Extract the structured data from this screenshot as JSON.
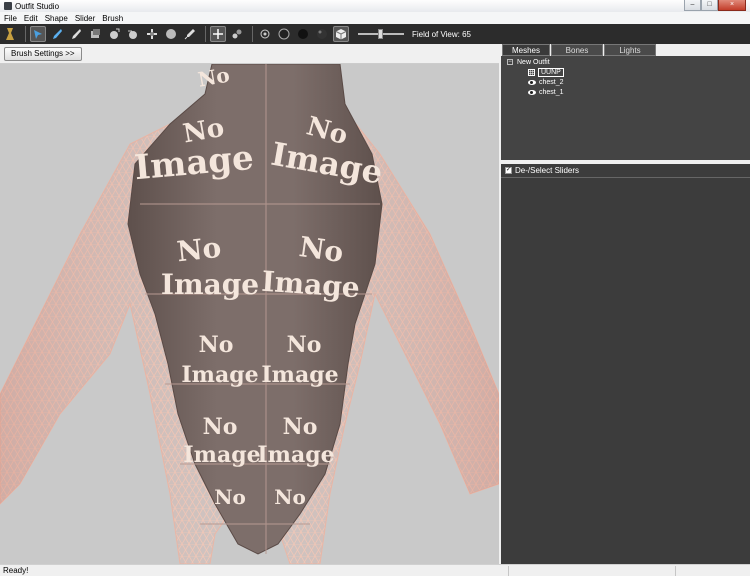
{
  "window": {
    "title": "Outfit Studio"
  },
  "menu": [
    "File",
    "Edit",
    "Shape",
    "Slider",
    "Brush"
  ],
  "toolbar": {
    "tools": [
      "outfit-studio-icon",
      "select-brush-icon",
      "mask-brush-icon",
      "inflate-brush-icon",
      "deflate-brush-icon",
      "move-brush-icon",
      "smooth-brush-icon",
      "undiff-brush-icon",
      "weight-brush-icon",
      "color-brush-icon",
      "transform-icon",
      "pivot-icon",
      "vertex-dot-icon",
      "sphere-icon",
      "sphere-shaded-icon",
      "sphere-textured-icon",
      "cube-icon"
    ],
    "fov_label": "Field of View: 65"
  },
  "brush_settings_label": "Brush Settings >>",
  "viewport": {
    "texture_text_line1": "No",
    "texture_text_line2": "Image"
  },
  "right_panel": {
    "tabs": [
      "Meshes",
      "Bones",
      "Lights"
    ],
    "tree": {
      "root": "New Outfit",
      "reference": "UUNP",
      "meshes": [
        "chest_2",
        "chest_1"
      ]
    },
    "sliders_header": "De-/Select Sliders"
  },
  "status": {
    "text": "Ready!"
  },
  "colors": {
    "toolbar_bg": "#2c2c2c",
    "viewport_bg": "#c9c9c9",
    "panel_dark": "#444444",
    "mesh_fill": "#7a6a66",
    "wire_color": "#f0c8b8"
  }
}
